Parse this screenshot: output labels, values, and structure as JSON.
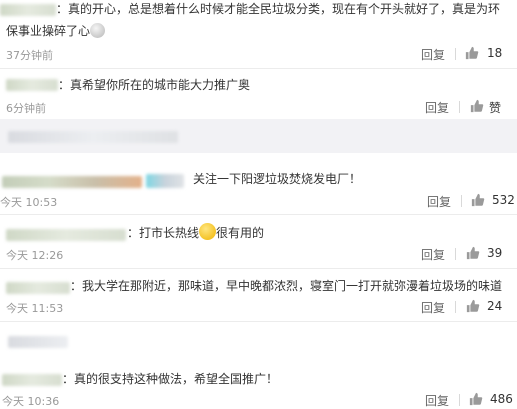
{
  "comments": [
    {
      "line1": "：真的开心，总是想着什么时候才能全民垃圾分类，现在有个开头就好了，真是为环",
      "line2": "保事业操碎了心",
      "time": "37分钟前",
      "reply_label": "回复",
      "likes": "18"
    },
    {
      "text": "：真希望你所在的城市能大力推广奥",
      "time": "6分钟前",
      "reply_label": "回复",
      "likes": "赞"
    },
    {
      "text": "关注一下阳逻垃圾焚烧发电厂！",
      "time": "今天 10:53",
      "reply_label": "回复",
      "likes": "532"
    },
    {
      "text_before": "：打市长热线",
      "text_after": "很有用的",
      "time": "今天 12:26",
      "reply_label": "回复",
      "likes": "39"
    },
    {
      "text": "：我大学在那附近，那味道，早中晚都浓烈，寝室门一打开就弥漫着垃圾场的味道",
      "time": "今天 11:53",
      "reply_label": "回复",
      "likes": "24"
    },
    {
      "text": "：真的很支持这种做法，希望全国推广！",
      "time": "今天 10:36",
      "reply_label": "回复",
      "likes": "486"
    }
  ],
  "icons": {
    "like": "thumbs-up-icon",
    "emoji_smile": "smile-emoji-icon",
    "emoji_sad": "sad-emoji-icon"
  },
  "colors": {
    "background": "#ffffff",
    "band": "#f2f2f5",
    "text": "#333333",
    "meta": "#999999"
  }
}
